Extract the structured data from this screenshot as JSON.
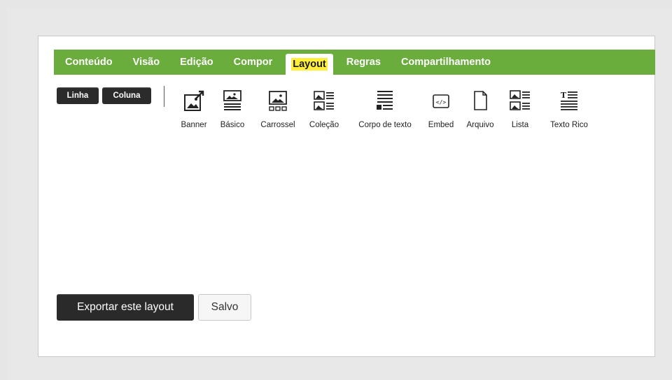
{
  "tabs": [
    {
      "label": "Conteúdo"
    },
    {
      "label": "Visão"
    },
    {
      "label": "Edição"
    },
    {
      "label": "Compor"
    },
    {
      "label": "Layout",
      "active": true
    },
    {
      "label": "Regras"
    },
    {
      "label": "Compartilhamento"
    }
  ],
  "toolbar": {
    "row_label": "Linha",
    "column_label": "Coluna"
  },
  "widgets": [
    {
      "label": "Banner",
      "icon": "banner-icon"
    },
    {
      "label": "Básico",
      "icon": "basic-icon"
    },
    {
      "label": "Carrossel",
      "icon": "carousel-icon"
    },
    {
      "label": "Coleção",
      "icon": "collection-icon"
    },
    {
      "label": "Corpo de texto",
      "icon": "text-body-icon"
    },
    {
      "label": "Embed",
      "icon": "embed-icon"
    },
    {
      "label": "Arquivo",
      "icon": "file-icon"
    },
    {
      "label": "Lista",
      "icon": "list-icon"
    },
    {
      "label": "Texto Rico",
      "icon": "rich-text-icon"
    }
  ],
  "actions": {
    "export_label": "Exportar este layout",
    "saved_label": "Salvo"
  },
  "colors": {
    "tab_bar": "#6aad3d",
    "highlight": "#ffef3a",
    "dark_button": "#2b2b2b"
  }
}
